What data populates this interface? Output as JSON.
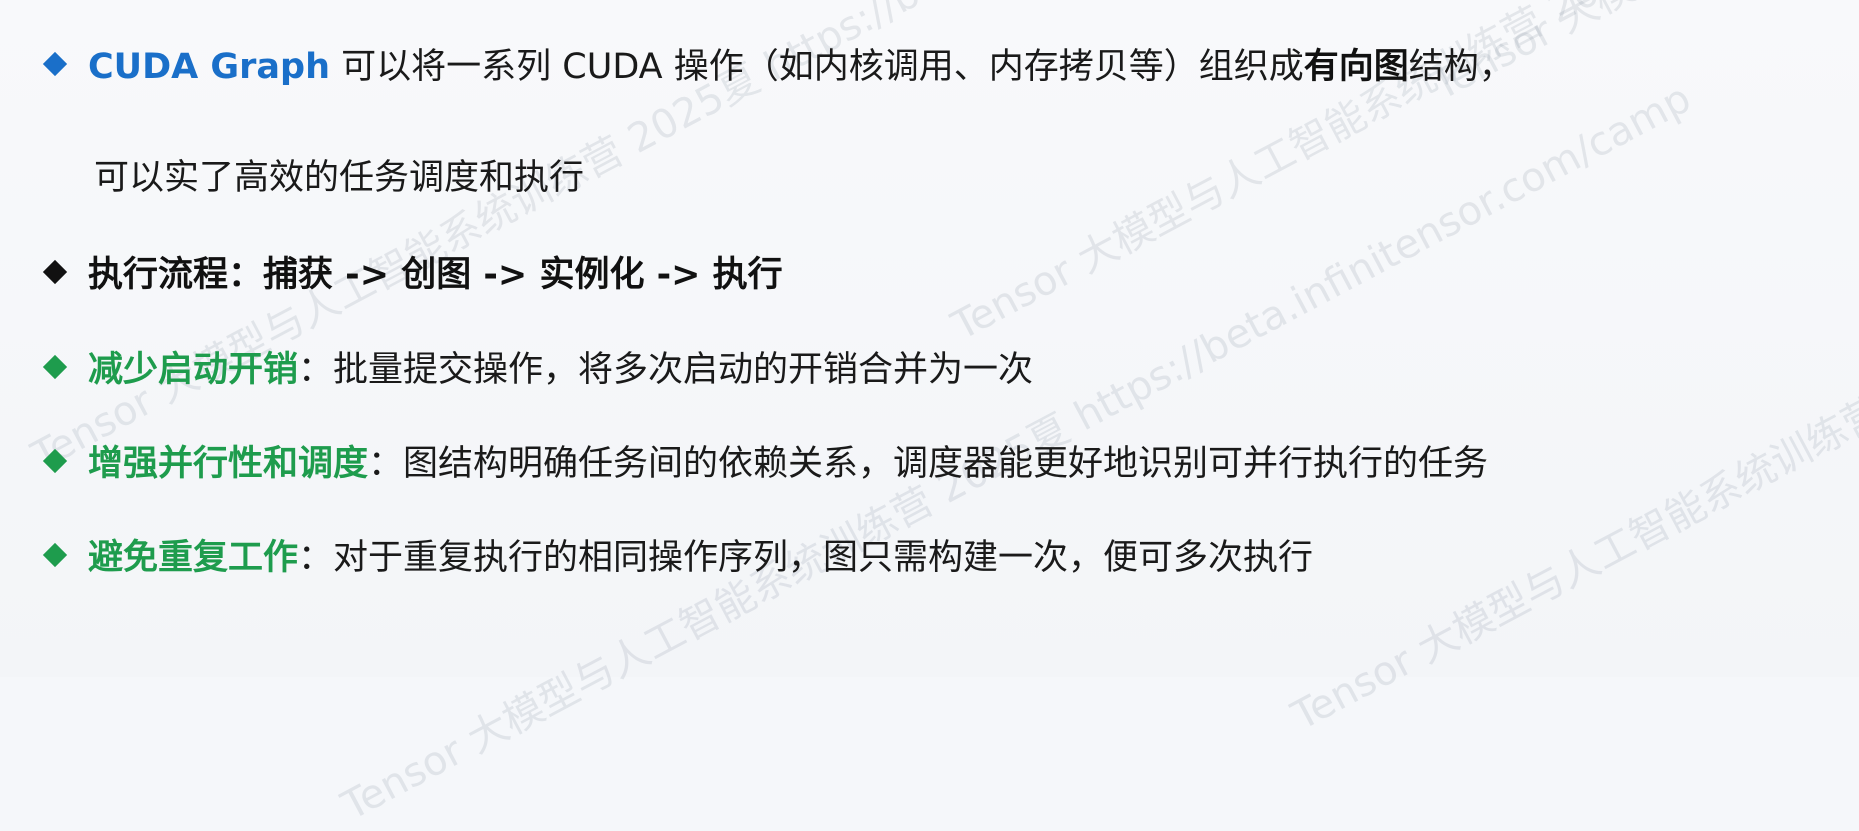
{
  "watermark": {
    "text": "Tensor 大模型与人工智能系统训练营 2025夏 https://beta.infinitensor.com/camp"
  },
  "colors": {
    "blue": "#1a6fc9",
    "green": "#1e9c4d",
    "black": "#111111"
  },
  "bullets": [
    {
      "icon": "blue-diamond-icon",
      "term": "CUDA Graph",
      "text_a": " 可以将一系列 CUDA 操作（如内核调用、内存拷贝等）组织成",
      "bold": "有向图",
      "text_b": "结构，",
      "continuation": "可以实了高效的任务调度和执行"
    },
    {
      "icon": "black-diamond-icon",
      "text": "执行流程：捕获 -> 创图 -> 实例化 -> 执行"
    },
    {
      "icon": "green-diamond-icon",
      "term": "减少启动开销",
      "separator": "：",
      "text": "批量提交操作，将多次启动的开销合并为一次"
    },
    {
      "icon": "green-diamond-icon",
      "term": "增强并行性和调度",
      "separator": "：",
      "text": "图结构明确任务间的依赖关系，调度器能更好地识别可并行执行的任务"
    },
    {
      "icon": "green-diamond-icon",
      "term": "避免重复工作",
      "separator": "：",
      "text": "对于重复执行的相同操作序列，图只需构建一次，便可多次执行"
    }
  ]
}
